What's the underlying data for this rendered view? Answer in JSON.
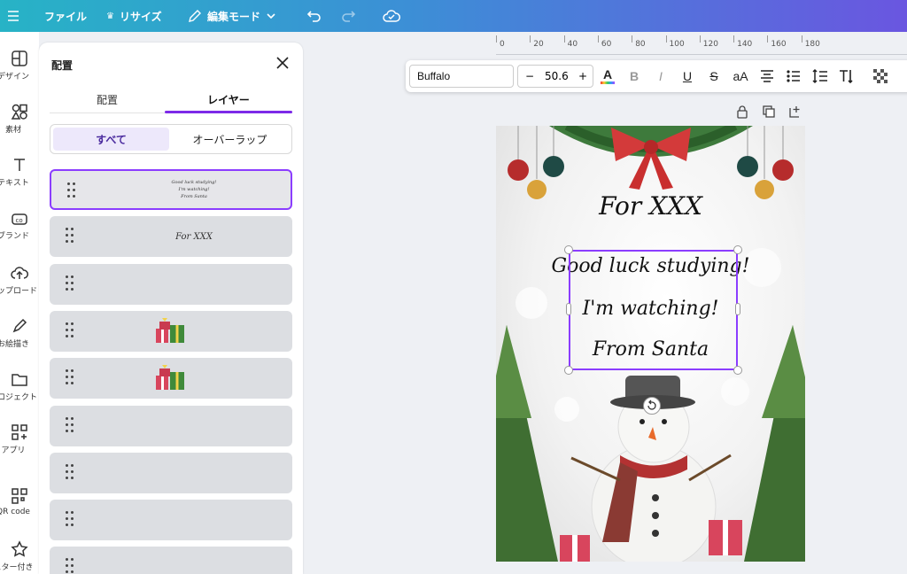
{
  "topbar": {
    "menu_icon": "hamburger-icon",
    "file_label": "ファイル",
    "resize_label": "リサイズ",
    "edit_mode_label": "編集モード"
  },
  "sidebar": {
    "items": [
      {
        "label": "デザイン",
        "icon": "layout-icon"
      },
      {
        "label": "素材",
        "icon": "elements-icon"
      },
      {
        "label": "テキスト",
        "icon": "text-icon"
      },
      {
        "label": "ブランド",
        "icon": "brand-icon"
      },
      {
        "label": "アップロード",
        "icon": "upload-icon"
      },
      {
        "label": "お絵描き",
        "icon": "draw-icon"
      },
      {
        "label": "プロジェクト",
        "icon": "folder-icon"
      },
      {
        "label": "アプリ",
        "icon": "apps-icon"
      },
      {
        "label": "QR code",
        "icon": "qr-icon"
      },
      {
        "label": "スター付き",
        "icon": "star-icon"
      }
    ]
  },
  "panel": {
    "title": "配置",
    "tabs": [
      {
        "label": "配置"
      },
      {
        "label": "レイヤー"
      }
    ],
    "filters": [
      {
        "label": "すべて"
      },
      {
        "label": "オーバーラップ"
      }
    ],
    "layers": [
      {
        "type": "text",
        "lines": [
          "Good luck studying!",
          "I'm watching!",
          "From Santa"
        ],
        "selected": true
      },
      {
        "type": "text",
        "lines": [
          "For XXX"
        ],
        "selected": false
      },
      {
        "type": "empty",
        "selected": false
      },
      {
        "type": "gift",
        "selected": false
      },
      {
        "type": "gift",
        "selected": false
      },
      {
        "type": "empty",
        "selected": false
      },
      {
        "type": "empty",
        "selected": false
      },
      {
        "type": "empty",
        "selected": false
      },
      {
        "type": "empty",
        "selected": false
      }
    ]
  },
  "ruler": {
    "ticks": [
      "0",
      "20",
      "40",
      "60",
      "80",
      "100",
      "120",
      "140",
      "160",
      "180"
    ]
  },
  "toolbar": {
    "font_name": "Buffalo",
    "font_size": "50.6",
    "minus": "−",
    "plus": "+",
    "text_color_glyph": "A",
    "bold": "B",
    "italic": "I",
    "underline": "U",
    "strike": "S",
    "case": "aA"
  },
  "card": {
    "title": "For XXX",
    "lines": [
      "Good luck studying!",
      "I'm watching!",
      "From Santa"
    ]
  }
}
